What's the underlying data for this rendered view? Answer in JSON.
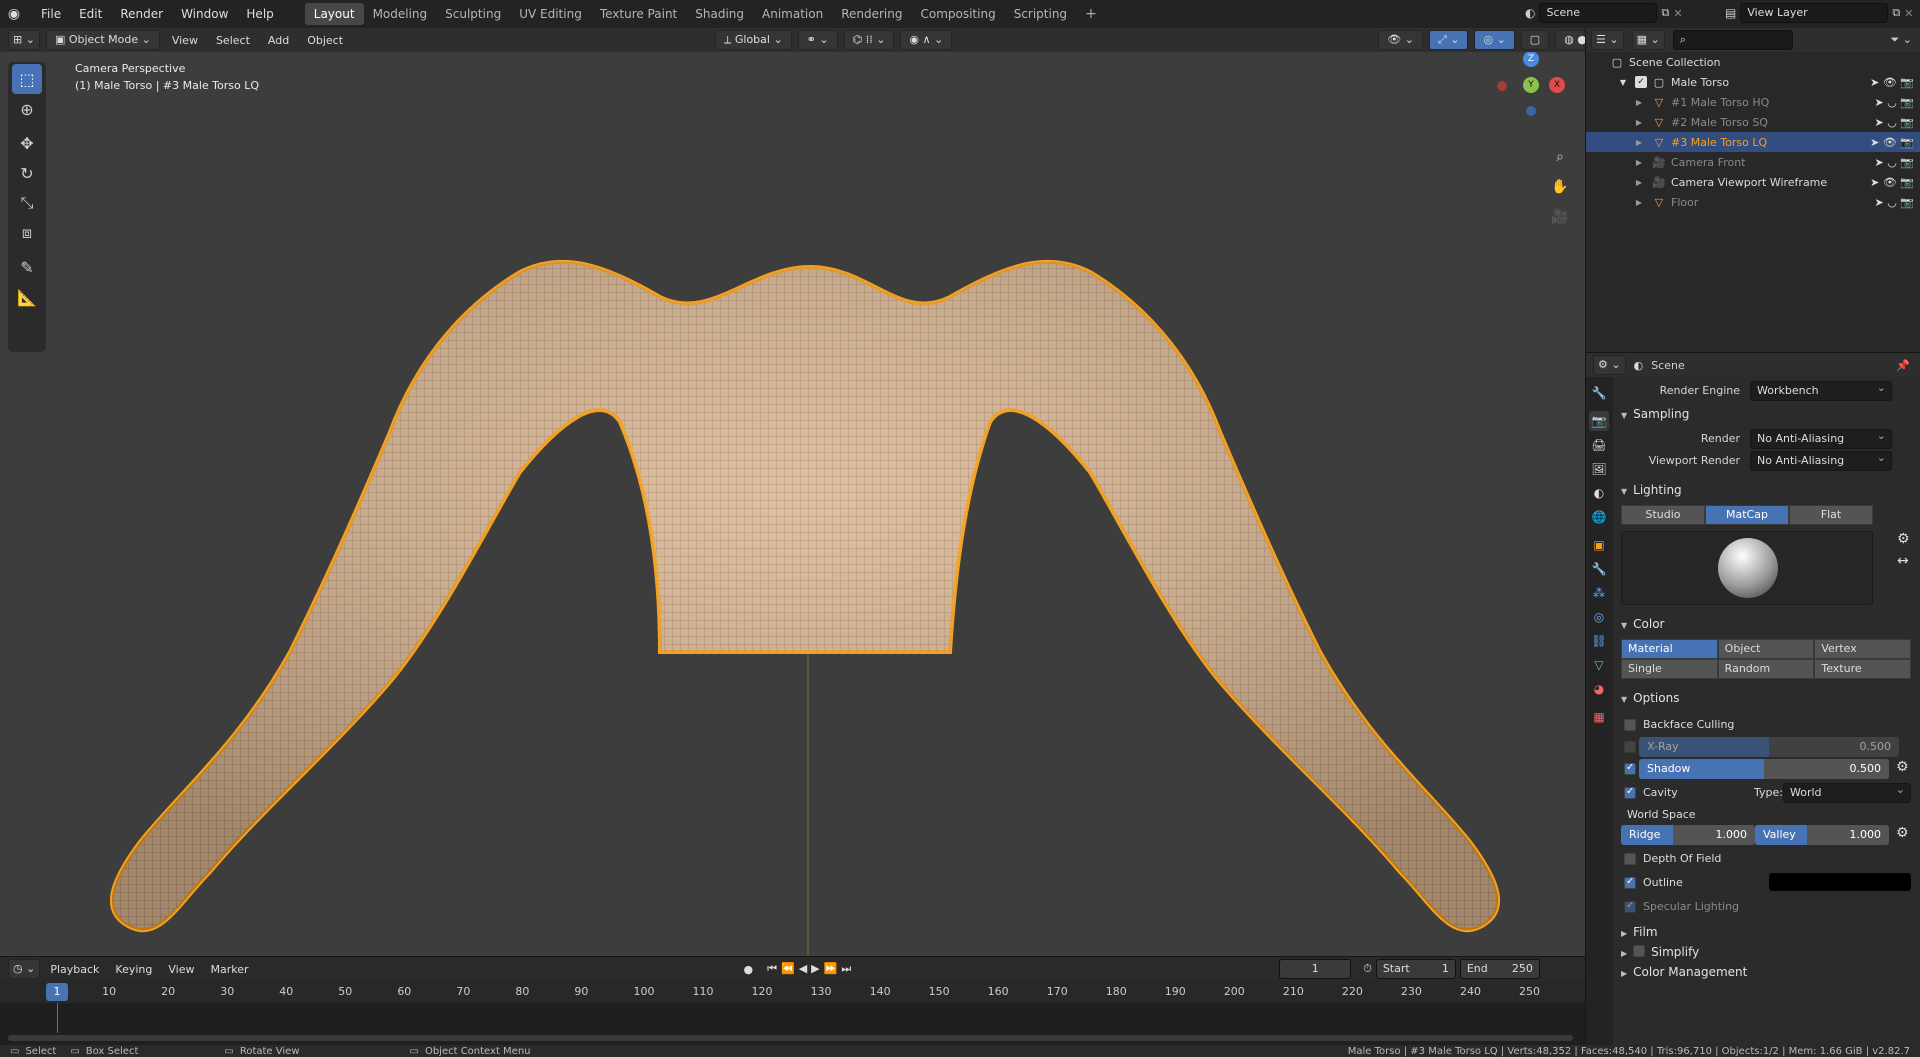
{
  "app": {
    "menus": [
      "File",
      "Edit",
      "Render",
      "Window",
      "Help"
    ],
    "workspaces": [
      "Layout",
      "Modeling",
      "Sculpting",
      "UV Editing",
      "Texture Paint",
      "Shading",
      "Animation",
      "Rendering",
      "Compositing",
      "Scripting"
    ],
    "active_workspace": "Layout",
    "scene_name": "Scene",
    "view_layer": "View Layer"
  },
  "viewport_header": {
    "mode": "Object Mode",
    "menus": [
      "View",
      "Select",
      "Add",
      "Object"
    ],
    "orientation": "Global"
  },
  "viewport": {
    "perspective_label": "Camera Perspective",
    "object_label": "(1) Male Torso | #3 Male Torso LQ",
    "gizmo": {
      "z": "Z",
      "y": "Y",
      "x": "X"
    }
  },
  "outliner": {
    "root": "Scene Collection",
    "collection": "Male Torso",
    "items": [
      {
        "name": "#1 Male Torso HQ",
        "selected": false,
        "dim": true
      },
      {
        "name": "#2 Male Torso SQ",
        "selected": false,
        "dim": true
      },
      {
        "name": "#3 Male Torso LQ",
        "selected": true,
        "dim": false
      },
      {
        "name": "Camera Front",
        "selected": false,
        "dim": true
      },
      {
        "name": "Camera Viewport Wireframe",
        "selected": false,
        "dim": false
      },
      {
        "name": "Floor",
        "selected": false,
        "dim": true
      }
    ]
  },
  "properties": {
    "context": "Scene",
    "render_engine_label": "Render Engine",
    "render_engine": "Workbench",
    "sampling": {
      "title": "Sampling",
      "render_label": "Render",
      "render_value": "No Anti-Aliasing",
      "viewport_label": "Viewport Render",
      "viewport_value": "No Anti-Aliasing"
    },
    "lighting": {
      "title": "Lighting",
      "options": [
        "Studio",
        "MatCap",
        "Flat"
      ],
      "active": "MatCap"
    },
    "color": {
      "title": "Color",
      "options": [
        "Material",
        "Object",
        "Vertex",
        "Single",
        "Random",
        "Texture"
      ],
      "active": "Material"
    },
    "options": {
      "title": "Options",
      "backface_culling": "Backface Culling",
      "xray_label": "X-Ray",
      "xray_value": "0.500",
      "xray_fraction": 0.5,
      "shadow_label": "Shadow",
      "shadow_value": "0.500",
      "shadow_fraction": 0.5,
      "cavity_label": "Cavity",
      "type_label": "Type:",
      "type_value": "World",
      "world_space": "World Space",
      "ridge_label": "Ridge",
      "ridge_value": "1.000",
      "valley_label": "Valley",
      "valley_value": "1.000",
      "dof_label": "Depth Of Field",
      "outline_label": "Outline",
      "specular_label": "Specular Lighting"
    },
    "film": "Film",
    "simplify": "Simplify",
    "color_management": "Color Management"
  },
  "timeline": {
    "menus": [
      "Playback",
      "Keying",
      "View",
      "Marker"
    ],
    "current_frame": "1",
    "start_label": "Start",
    "start": "1",
    "end_label": "End",
    "end": "250",
    "ruler": [
      "1",
      "10",
      "20",
      "30",
      "40",
      "50",
      "60",
      "70",
      "80",
      "90",
      "100",
      "110",
      "120",
      "130",
      "140",
      "150",
      "160",
      "170",
      "180",
      "190",
      "200",
      "210",
      "220",
      "230",
      "240",
      "250"
    ]
  },
  "statusbar": {
    "select": "Select",
    "box_select": "Box Select",
    "rotate": "Rotate View",
    "context_menu": "Object Context Menu",
    "stats": "Male Torso | #3 Male Torso LQ | Verts:48,352 | Faces:48,540 | Tris:96,710 | Objects:1/2 | Mem: 1.66 GiB | v2.82.7"
  },
  "colors": {
    "accent": "#4772b3",
    "selection_orange": "#f5a020",
    "viewport_bg": "#3d3d3d",
    "axis_x": "#e44a4a",
    "axis_y": "#8bc34a",
    "axis_z": "#4a8ae4"
  }
}
